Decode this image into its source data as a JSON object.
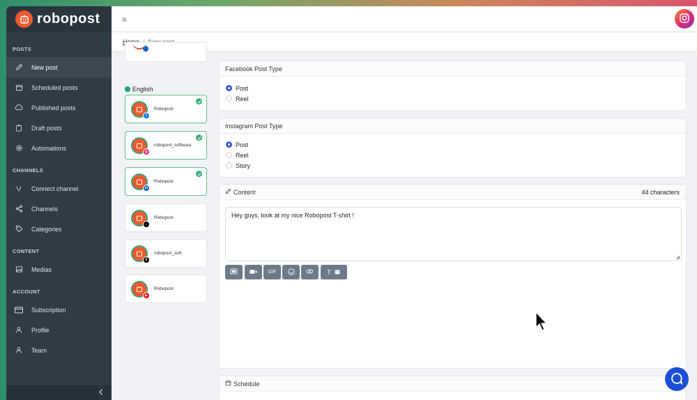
{
  "brand": {
    "name": "robopost"
  },
  "sidebar": {
    "sections": {
      "posts": "POSTS",
      "channels": "CHANNELS",
      "content": "CONTENT",
      "account": "ACCOUNT"
    },
    "items": [
      {
        "label": "New post",
        "icon": "pencil-icon"
      },
      {
        "label": "Scheduled posts",
        "icon": "calendar-icon"
      },
      {
        "label": "Published posts",
        "icon": "cloud-upload-icon"
      },
      {
        "label": "Draft posts",
        "icon": "clipboard-icon"
      },
      {
        "label": "Automations",
        "icon": "gear-icon"
      },
      {
        "label": "Connect channel",
        "icon": "plug-icon"
      },
      {
        "label": "Channels",
        "icon": "share-icon"
      },
      {
        "label": "Categories",
        "icon": "tag-icon"
      },
      {
        "label": "Medias",
        "icon": "image-icon"
      },
      {
        "label": "Subscription",
        "icon": "credit-card-icon"
      },
      {
        "label": "Profile",
        "icon": "user-icon"
      },
      {
        "label": "Team",
        "icon": "team-icon"
      }
    ]
  },
  "breadcrumb": {
    "home": "Home",
    "separator": "/",
    "current": "New post"
  },
  "language": {
    "label": "English"
  },
  "accounts": [
    {
      "name": "Robopost",
      "network": "facebook",
      "badge_color": "#1877f2",
      "selected": true
    },
    {
      "name": "robopost_software",
      "network": "instagram",
      "badge_color": "#e1306c",
      "selected": true
    },
    {
      "name": "Robopost",
      "network": "linkedin",
      "badge_color": "#0a66c2",
      "selected": true
    },
    {
      "name": "Robopost",
      "network": "tiktok",
      "badge_color": "#000000",
      "selected": false
    },
    {
      "name": "robopost_soft",
      "network": "x",
      "badge_color": "#000000",
      "selected": false
    },
    {
      "name": "Robopost",
      "network": "youtube",
      "badge_color": "#ff0000",
      "selected": false
    }
  ],
  "facebook": {
    "title": "Facebook Post Type",
    "options": [
      "Post",
      "Reel"
    ],
    "selected": "Post"
  },
  "instagram": {
    "title": "Instagram Post Type",
    "options": [
      "Post",
      "Reel",
      "Story"
    ],
    "selected": "Post"
  },
  "content": {
    "title": "Content",
    "char_count": "44 characters",
    "text": "Hey guys, look at my nice Robopost T-shirt !",
    "toolbar": [
      {
        "name": "image-icon",
        "label": ""
      },
      {
        "name": "video-icon",
        "label": ""
      },
      {
        "name": "gif-icon",
        "label": "GIF"
      },
      {
        "name": "emoji-icon",
        "label": ""
      },
      {
        "name": "link-icon",
        "label": ""
      },
      {
        "name": "ai-text-icon",
        "label": "T"
      }
    ]
  },
  "schedule": {
    "title": "Schedule"
  },
  "colors": {
    "accent": "#3b5bdb",
    "brand": "#ee5a2e",
    "sidebar": "#2f3b45",
    "success": "#3ab07a"
  }
}
